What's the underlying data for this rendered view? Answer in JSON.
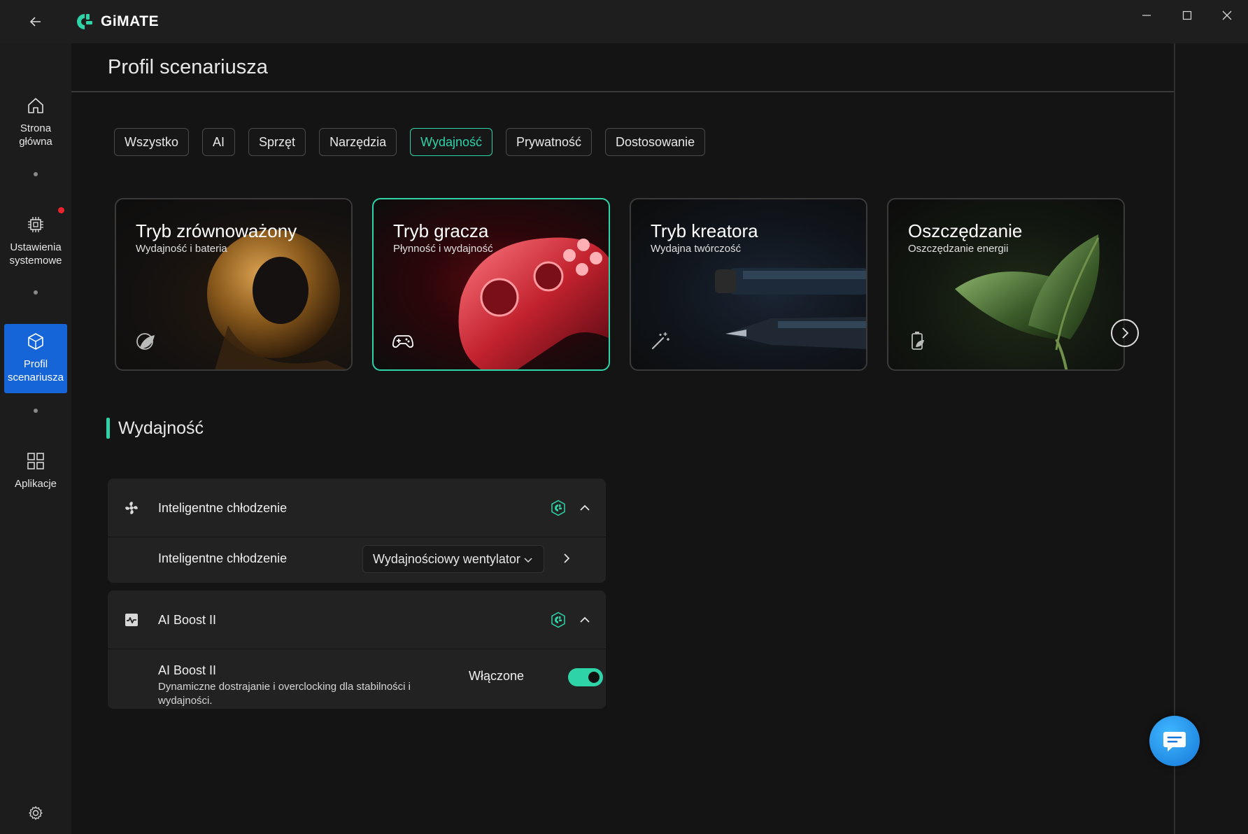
{
  "app": {
    "name": "GiMATE"
  },
  "colors": {
    "accent": "#2fd3a8",
    "nav_active": "#1565d8",
    "notification": "#e8252d"
  },
  "sidebar": {
    "items": [
      {
        "label_line1": "Strona",
        "label_line2": "główna",
        "icon": "home-icon"
      },
      {
        "label_line1": "Ustawienia",
        "label_line2": "systemowe",
        "icon": "chip-icon",
        "badge": "notification-dot"
      },
      {
        "label_line1": "Profil",
        "label_line2": "scenariusza",
        "icon": "cube-icon",
        "active": true
      },
      {
        "label_line1": "Aplikacje",
        "label_line2": "",
        "icon": "apps-grid-icon"
      }
    ],
    "settings_icon": "gear-icon"
  },
  "page": {
    "title": "Profil scenariusza"
  },
  "tabs": [
    {
      "label": "Wszystko"
    },
    {
      "label": "AI"
    },
    {
      "label": "Sprzęt"
    },
    {
      "label": "Narzędzia"
    },
    {
      "label": "Wydajność",
      "active": true
    },
    {
      "label": "Prywatność"
    },
    {
      "label": "Dostosowanie"
    }
  ],
  "cards": [
    {
      "title": "Tryb zrównoważony",
      "subtitle": "Wydajność i bateria",
      "icon": "balance-leaf-icon"
    },
    {
      "title": "Tryb gracza",
      "subtitle": "Płynność i wydajność",
      "icon": "gamepad-icon",
      "active": true
    },
    {
      "title": "Tryb kreatora",
      "subtitle": "Wydajna twórczość",
      "icon": "magic-wand-icon"
    },
    {
      "title": "Oszczędzanie",
      "subtitle": "Oszczędzanie energii",
      "icon": "battery-leaf-icon"
    }
  ],
  "section": {
    "title": "Wydajność"
  },
  "panels": {
    "cooling": {
      "header": "Inteligentne chłodzenie",
      "row_label": "Inteligentne chłodzenie",
      "dropdown_value": "Wydajnościowy wentylator"
    },
    "ai_boost": {
      "header": "AI Boost II",
      "row_label": "AI Boost II",
      "description": "Dynamiczne dostrajanie i overclocking dla stabilności i wydajności.",
      "toggle_label": "Włączone",
      "toggle_on": true
    }
  }
}
